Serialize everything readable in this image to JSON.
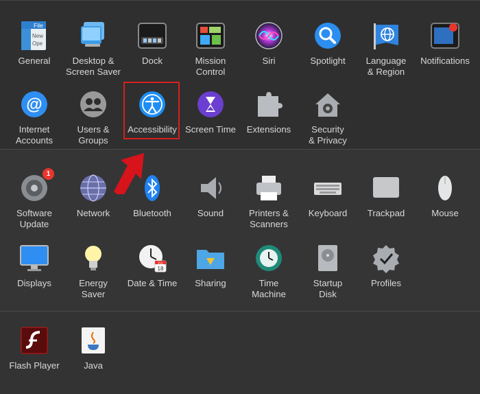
{
  "sections": [
    {
      "items": [
        {
          "id": "general",
          "label": "General",
          "icon": "general-icon"
        },
        {
          "id": "desktop",
          "label": "Desktop &\nScreen Saver",
          "icon": "desktop-icon"
        },
        {
          "id": "dock",
          "label": "Dock",
          "icon": "dock-icon"
        },
        {
          "id": "mission",
          "label": "Mission\nControl",
          "icon": "mission-control-icon"
        },
        {
          "id": "siri",
          "label": "Siri",
          "icon": "siri-icon"
        },
        {
          "id": "spotlight",
          "label": "Spotlight",
          "icon": "spotlight-icon"
        },
        {
          "id": "language",
          "label": "Language\n& Region",
          "icon": "globe-icon"
        },
        {
          "id": "notifications",
          "label": "Notifications",
          "icon": "notifications-icon"
        },
        {
          "id": "internet",
          "label": "Internet\nAccounts",
          "icon": "at-icon"
        },
        {
          "id": "users",
          "label": "Users &\nGroups",
          "icon": "users-icon"
        },
        {
          "id": "accessibility",
          "label": "Accessibility",
          "icon": "accessibility-icon"
        },
        {
          "id": "screentime",
          "label": "Screen Time",
          "icon": "hourglass-icon"
        },
        {
          "id": "extensions",
          "label": "Extensions",
          "icon": "puzzle-icon"
        },
        {
          "id": "security",
          "label": "Security\n& Privacy",
          "icon": "house-lock-icon"
        }
      ]
    },
    {
      "items": [
        {
          "id": "softwareupdate",
          "label": "Software\nUpdate",
          "icon": "gear-icon",
          "badge": "1"
        },
        {
          "id": "network",
          "label": "Network",
          "icon": "network-globe-icon"
        },
        {
          "id": "bluetooth",
          "label": "Bluetooth",
          "icon": "bluetooth-icon"
        },
        {
          "id": "sound",
          "label": "Sound",
          "icon": "speaker-icon"
        },
        {
          "id": "printers",
          "label": "Printers &\nScanners",
          "icon": "printer-icon"
        },
        {
          "id": "keyboard",
          "label": "Keyboard",
          "icon": "keyboard-icon"
        },
        {
          "id": "trackpad",
          "label": "Trackpad",
          "icon": "trackpad-icon"
        },
        {
          "id": "mouse",
          "label": "Mouse",
          "icon": "mouse-icon"
        },
        {
          "id": "displays",
          "label": "Displays",
          "icon": "display-icon"
        },
        {
          "id": "energy",
          "label": "Energy\nSaver",
          "icon": "lightbulb-icon"
        },
        {
          "id": "datetime",
          "label": "Date & Time",
          "icon": "clock-icon",
          "date_num": "18",
          "date_month": "JUL"
        },
        {
          "id": "sharing",
          "label": "Sharing",
          "icon": "sharing-folder-icon"
        },
        {
          "id": "timemachine",
          "label": "Time\nMachine",
          "icon": "time-machine-icon"
        },
        {
          "id": "startup",
          "label": "Startup\nDisk",
          "icon": "disk-icon"
        },
        {
          "id": "profiles",
          "label": "Profiles",
          "icon": "badge-check-icon"
        }
      ]
    },
    {
      "items": [
        {
          "id": "flash",
          "label": "Flash Player",
          "icon": "flash-icon"
        },
        {
          "id": "java",
          "label": "Java",
          "icon": "java-icon"
        }
      ]
    }
  ],
  "general_icon_text": {
    "line1": "File",
    "line2": "New",
    "line3": "Ope"
  },
  "highlighted": "accessibility",
  "colors": {
    "highlight": "#d6201e",
    "arrow": "#d7131b",
    "badge": "#e8362e"
  }
}
